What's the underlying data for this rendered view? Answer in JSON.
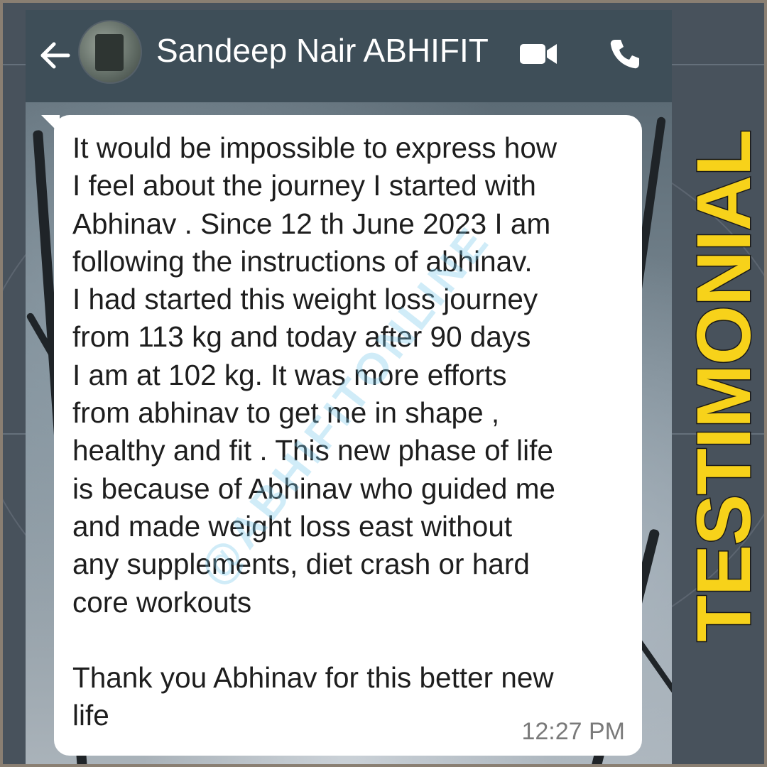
{
  "header": {
    "contact_name": "Sandeep Nair ABHIFIT",
    "back_icon": "arrow-left-icon",
    "video_icon": "video-camera-icon",
    "call_icon": "phone-icon"
  },
  "message": {
    "text": "It would be impossible to express how\nI feel about the journey I started with\nAbhinav . Since 12 th June 2023 I am\nfollowing the instructions of abhinav.\nI had started this weight loss journey\nfrom 113 kg and today after 90 days\nI am at 102 kg. It was more efforts\nfrom abhinav to get me in shape ,\nhealthy and fit . This new phase of life\nis because of Abhinav who guided me\nand made weight loss east without\nany supplements, diet crash or hard\ncore workouts\n\nThank you Abhinav for this better new\nlife",
    "time": "12:27 PM"
  },
  "watermark": "@ABHIFITONLINE",
  "side_label": "TESTIMONIAL",
  "colors": {
    "header_bg": "#3e4e58",
    "bubble_bg": "#ffffff",
    "label_yellow": "#f7d21a",
    "watermark": "#78c8eb"
  }
}
